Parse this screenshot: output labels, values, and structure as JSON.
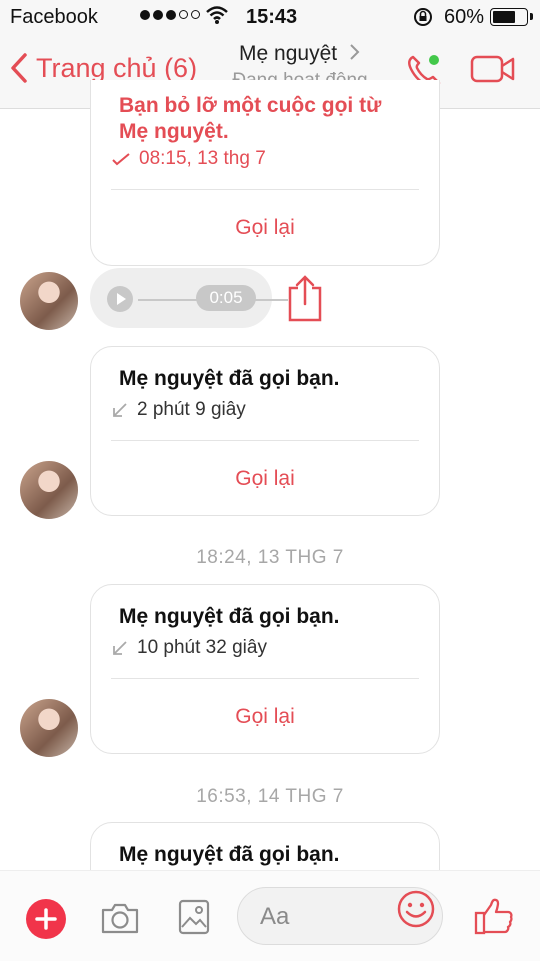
{
  "status_bar": {
    "carrier": "Facebook",
    "time": "15:43",
    "battery_pct": "60%"
  },
  "nav": {
    "back_label": "Trang chủ (6)",
    "contact_name": "Mẹ nguyệt",
    "contact_status": "Đang hoạt động"
  },
  "messages": {
    "partial_card": {
      "title_line1": "Bạn bỏ lỡ một cuộc gọi từ",
      "title_line2": "Mẹ nguyệt.",
      "time": "08:15, 13 thg 7",
      "recall": "Gọi lại"
    },
    "audio": {
      "duration": "0:05"
    },
    "card1": {
      "title": "Mẹ nguyệt đã gọi bạn.",
      "duration": "2 phút 9 giây",
      "recall": "Gọi lại"
    },
    "stamp1": "18:24, 13 THG 7",
    "card2": {
      "title": "Mẹ nguyệt đã gọi bạn.",
      "duration": "10 phút 32 giây",
      "recall": "Gọi lại"
    },
    "stamp2": "16:53, 14 THG 7",
    "card3": {
      "title": "Mẹ nguyệt đã gọi bạn."
    }
  },
  "composer": {
    "placeholder": "Aa"
  },
  "colors": {
    "accent": "#e44d55",
    "plus": "#f1344a"
  }
}
